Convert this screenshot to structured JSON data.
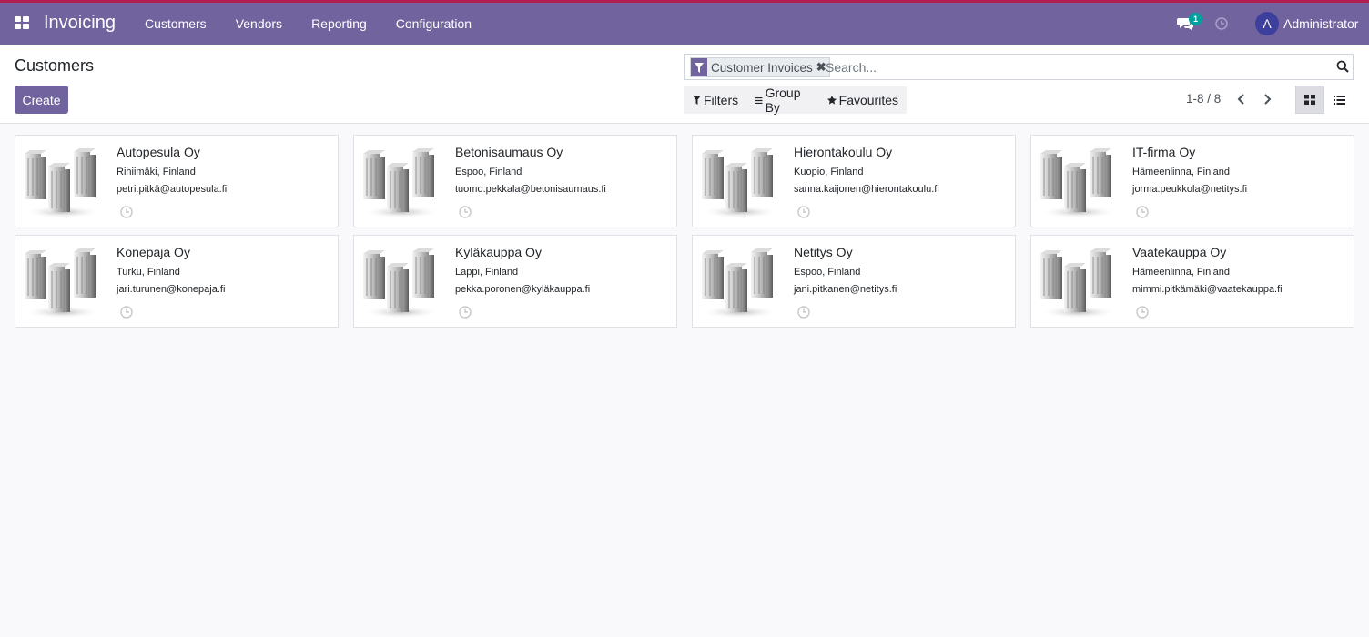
{
  "app": {
    "title": "Invoicing"
  },
  "nav": {
    "items": [
      "Customers",
      "Vendors",
      "Reporting",
      "Configuration"
    ]
  },
  "systray": {
    "messages_count": "1",
    "user_initial": "A",
    "user_name": "Administrator"
  },
  "control_panel": {
    "page_title": "Customers",
    "create_label": "Create",
    "facet_label": "Customer Invoices",
    "search_placeholder": "Search...",
    "filters_label": "Filters",
    "group_by_label": "Group By",
    "favourites_label": "Favourites",
    "pager": "1-8 / 8"
  },
  "colors": {
    "brand": "#71639e",
    "accent_top": "#b21f4f",
    "badge": "#00a09d",
    "avatar": "#3c3f9c"
  },
  "icons": [
    "apps-icon",
    "chat-icon",
    "clock-icon",
    "filter-icon",
    "close-icon",
    "search-icon",
    "bars-icon",
    "star-icon",
    "chevron-left-icon",
    "chevron-right-icon",
    "kanban-view-icon",
    "list-view-icon",
    "building-image"
  ],
  "customers": [
    {
      "name": "Autopesula Oy",
      "location": "Rihiimäki, Finland",
      "email": "petri.pitkä@autopesula.fi"
    },
    {
      "name": "Betonisaumaus Oy",
      "location": "Espoo, Finland",
      "email": "tuomo.pekkala@betonisaumaus.fi"
    },
    {
      "name": "Hierontakoulu Oy",
      "location": "Kuopio, Finland",
      "email": "sanna.kaijonen@hierontakoulu.fi"
    },
    {
      "name": "IT-firma Oy",
      "location": "Hämeenlinna, Finland",
      "email": "jorma.peukkola@netitys.fi"
    },
    {
      "name": "Konepaja Oy",
      "location": "Turku, Finland",
      "email": "jari.turunen@konepaja.fi"
    },
    {
      "name": "Kyläkauppa Oy",
      "location": "Lappi, Finland",
      "email": "pekka.poronen@kyläkauppa.fi"
    },
    {
      "name": "Netitys Oy",
      "location": "Espoo, Finland",
      "email": "jani.pitkanen@netitys.fi"
    },
    {
      "name": "Vaatekauppa Oy",
      "location": "Hämeenlinna, Finland",
      "email": "mimmi.pitkämäki@vaatekauppa.fi"
    }
  ]
}
